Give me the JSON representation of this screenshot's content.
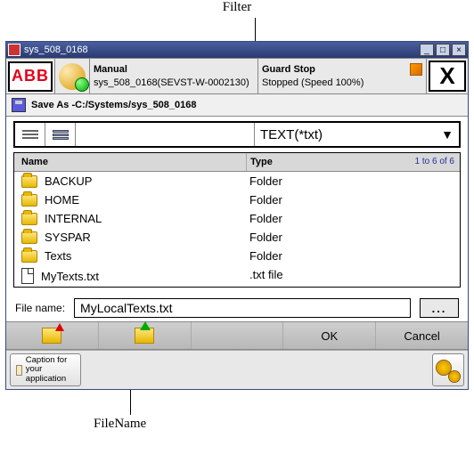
{
  "annotations": {
    "top": "Filter",
    "bottom": "FileName"
  },
  "window": {
    "title": "sys_508_0168"
  },
  "header": {
    "logo": "ABB",
    "manual_label": "Manual",
    "system_id": "sys_508_0168(SEVST-W-0002130)",
    "guard_label": "Guard Stop",
    "guard_status": "Stopped (Speed 100%)"
  },
  "saveas": {
    "prefix": "Save As - ",
    "path": "C:/Systems/sys_508_0168"
  },
  "filter": {
    "value": "TEXT(*txt)"
  },
  "table": {
    "col_name": "Name",
    "col_type": "Type",
    "count_text": "1 to 6 of 6",
    "rows": [
      {
        "icon": "folder",
        "name": "BACKUP",
        "type": "Folder"
      },
      {
        "icon": "folder",
        "name": "HOME",
        "type": "Folder"
      },
      {
        "icon": "folder",
        "name": "INTERNAL",
        "type": "Folder"
      },
      {
        "icon": "folder",
        "name": "SYSPAR",
        "type": "Folder"
      },
      {
        "icon": "folder",
        "name": "Texts",
        "type": "Folder"
      },
      {
        "icon": "file",
        "name": "MyTexts.txt",
        "type": ".txt file"
      }
    ]
  },
  "filename": {
    "label": "File name:",
    "value": "MyLocalTexts.txt",
    "browse": "..."
  },
  "actions": {
    "ok": "OK",
    "cancel": "Cancel"
  },
  "footer": {
    "caption_tab": "Caption for your application"
  }
}
